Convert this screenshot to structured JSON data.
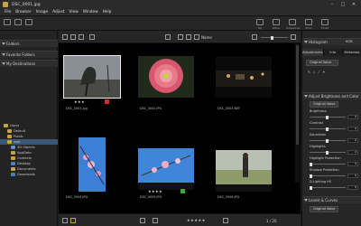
{
  "window": {
    "title": "DSC_0001.jpg"
  },
  "menu": [
    "File",
    "Browser",
    "Image",
    "Adjust",
    "View",
    "Window",
    "Help"
  ],
  "toolbar": {
    "right_labels": [
      "My Albums",
      "Other Input",
      "Slideshow",
      "Print",
      "Email"
    ]
  },
  "left_panel": {
    "sections": [
      "Folders",
      "Favorite Folders",
      "My Destinations"
    ],
    "tree": [
      "Users",
      "Default",
      "Public",
      "user",
      "3D Objects",
      "AppData",
      "Contacts",
      "Desktop",
      "Documents",
      "Downloads"
    ],
    "selected_index": 3
  },
  "center": {
    "sort_label": "Name",
    "thumbnails": [
      {
        "file": "DSC_0001.jpg",
        "stars": "★★★",
        "badge_color": "#d42a2a",
        "selected": true
      },
      {
        "file": "DSC_0002.JPG",
        "stars": "",
        "badge_color": "",
        "selected": false
      },
      {
        "file": "DSC_0003.NEF",
        "stars": "",
        "badge_color": "",
        "selected": false
      },
      {
        "file": "DSC_0004.JPG",
        "stars": "",
        "badge_color": "",
        "selected": false
      },
      {
        "file": "DSC_0005.JPG",
        "stars": "★★★★",
        "badge_color": "#3ea845",
        "selected": false
      },
      {
        "file": "DSC_0006.JPG",
        "stars": "",
        "badge_color": "",
        "selected": false
      }
    ],
    "bottom_rating": "★★★★★",
    "page_indicator": "1 / 20"
  },
  "right_panel": {
    "histogram_label": "Histogram",
    "histogram_mode": "RGB",
    "tabs": [
      "Adjustments",
      "Info",
      "Metadata"
    ],
    "original_value": "Original Value",
    "section_title": "Adjust Brightness and Color",
    "sliders": [
      {
        "label": "Brightness",
        "value": "0"
      },
      {
        "label": "Contrast",
        "value": "0"
      },
      {
        "label": "Saturation",
        "value": "0"
      },
      {
        "label": "Highlights",
        "value": "0"
      },
      {
        "label": "Highlight Protection",
        "value": "0"
      },
      {
        "label": "Shadow Protection",
        "value": "0"
      },
      {
        "label": "D-Lighting HS",
        "value": "0"
      }
    ],
    "levels_title": "Levels & Curves",
    "levels_value": "Original Value"
  },
  "colors": {
    "accent": "#3a5678",
    "folder": "#c9a43a",
    "bg": "#1b1b1b"
  }
}
